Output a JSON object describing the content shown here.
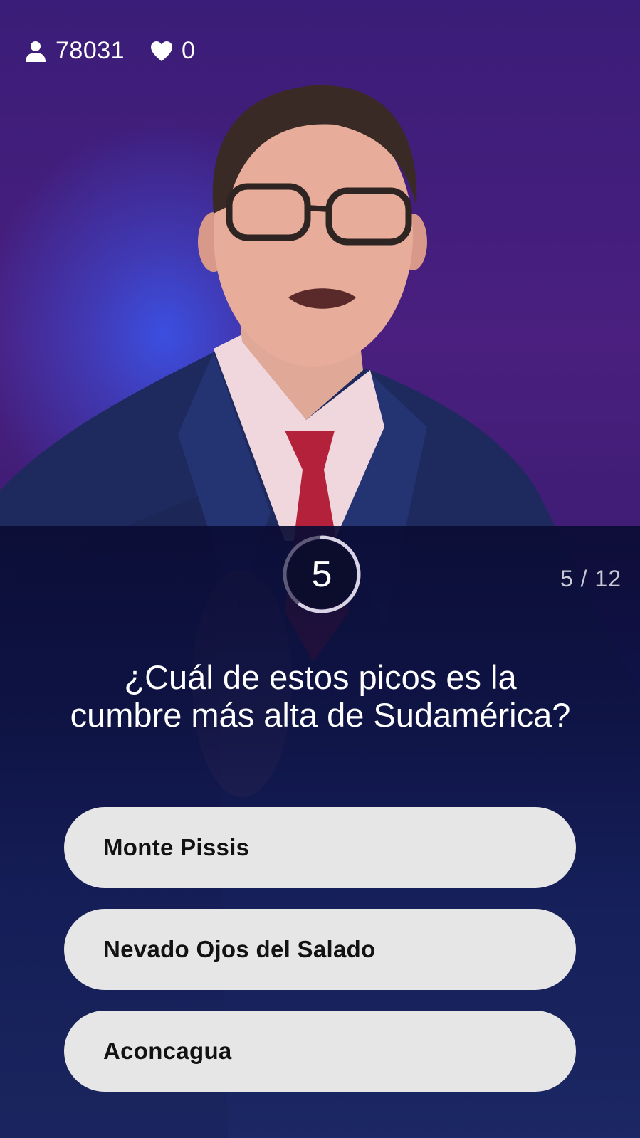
{
  "stats": {
    "players_icon": "user-icon",
    "players_count": "78031",
    "lives_icon": "heart-icon",
    "lives_count": "0"
  },
  "quiz": {
    "timer_value": "5",
    "timer_progress": 0.6,
    "progress_text": "5 / 12",
    "question": "¿Cuál de estos picos es la cumbre más alta de Sudamérica?",
    "answers": [
      {
        "label": "Monte Pissis"
      },
      {
        "label": "Nevado Ojos del Salado"
      },
      {
        "label": "Aconcagua"
      }
    ]
  },
  "colors": {
    "background_purple": "#4a1f7f",
    "background_blue": "#1b2b84",
    "panel_dark": "#0a0c34",
    "answer_bg": "#e6e6e6",
    "answer_text": "#121212",
    "timer_ring": "#d9d3e6"
  }
}
